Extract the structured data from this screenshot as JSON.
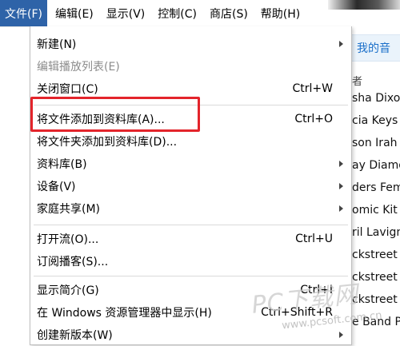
{
  "menubar": {
    "items": [
      {
        "label": "文件(F)",
        "active": true
      },
      {
        "label": "编辑(E)"
      },
      {
        "label": "显示(V)"
      },
      {
        "label": "控制(C)"
      },
      {
        "label": "商店(S)"
      },
      {
        "label": "帮助(H)"
      }
    ]
  },
  "background": {
    "link_text": "我的音",
    "header": "者",
    "rows": [
      "sha Dixo",
      "cia Keys",
      "son Irah",
      "ay Diamo",
      "ders Fem",
      "omic Kit",
      "ril Lavign",
      "ckstreet",
      "ckstreet",
      "ckstreet",
      "e Band P"
    ]
  },
  "menu": {
    "items": [
      {
        "label": "新建(N)",
        "shortcut": "",
        "submenu": true,
        "disabled": false
      },
      {
        "label": "编辑播放列表(E)",
        "shortcut": "",
        "submenu": false,
        "disabled": true
      },
      {
        "label": "关闭窗口(C)",
        "shortcut": "Ctrl+W",
        "submenu": false,
        "disabled": false
      },
      {
        "label": "将文件添加到资料库(A)...",
        "shortcut": "Ctrl+O",
        "submenu": false,
        "disabled": false,
        "highlighted": true
      },
      {
        "label": "将文件夹添加到资料库(D)...",
        "shortcut": "",
        "submenu": false,
        "disabled": false
      },
      {
        "label": "资料库(B)",
        "shortcut": "",
        "submenu": true,
        "disabled": false
      },
      {
        "label": "设备(V)",
        "shortcut": "",
        "submenu": true,
        "disabled": false
      },
      {
        "label": "家庭共享(M)",
        "shortcut": "",
        "submenu": true,
        "disabled": false
      },
      {
        "label": "打开流(O)...",
        "shortcut": "Ctrl+U",
        "submenu": false,
        "disabled": false
      },
      {
        "label": "订阅播客(S)...",
        "shortcut": "",
        "submenu": false,
        "disabled": false
      },
      {
        "label": "显示简介(G)",
        "shortcut": "Ctrl+I",
        "submenu": false,
        "disabled": false
      },
      {
        "label": "在 Windows 资源管理器中显示(H)",
        "shortcut": "Ctrl+Shift+R",
        "submenu": false,
        "disabled": false
      },
      {
        "label": "创建新版本(W)",
        "shortcut": "",
        "submenu": true,
        "disabled": false
      }
    ]
  },
  "highlight_color": "#e3242b",
  "accent_color": "#2e63a8",
  "watermark": {
    "text": "PC下载网",
    "url": "www.pcsoft.com.cn"
  }
}
